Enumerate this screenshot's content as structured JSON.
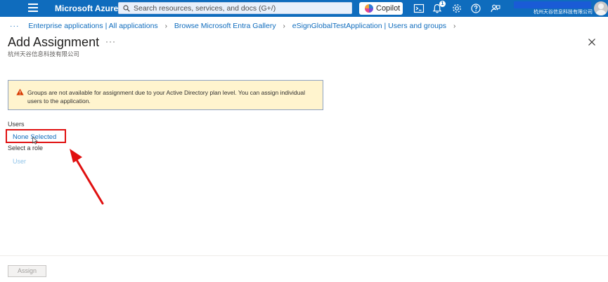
{
  "topbar": {
    "brand": "Microsoft Azure",
    "search_placeholder": "Search resources, services, and docs (G+/)",
    "copilot_label": "Copilot",
    "notification_count": "1",
    "account_org": "杭州天谷信息科技有限公司"
  },
  "breadcrumb": {
    "more": "···",
    "items": [
      "Enterprise applications | All applications",
      "Browse Microsoft Entra Gallery",
      "eSignGlobalTestApplication | Users and groups"
    ]
  },
  "page": {
    "title": "Add Assignment",
    "title_more": "···",
    "subtitle": "杭州天谷信息科技有限公司"
  },
  "warning": {
    "text": "Groups are not available for assignment due to your Active Directory plan level. You can assign individual users to the application."
  },
  "form": {
    "users_label": "Users",
    "users_value": "None Selected",
    "role_label": "Select a role",
    "role_value": "User"
  },
  "footer": {
    "assign_label": "Assign"
  },
  "colors": {
    "topbar": "#0f6cbd",
    "link": "#0f6cbd",
    "warning_bg": "#fff4ce",
    "warning_icon": "#d83b01",
    "annotation_red": "#e01010"
  }
}
